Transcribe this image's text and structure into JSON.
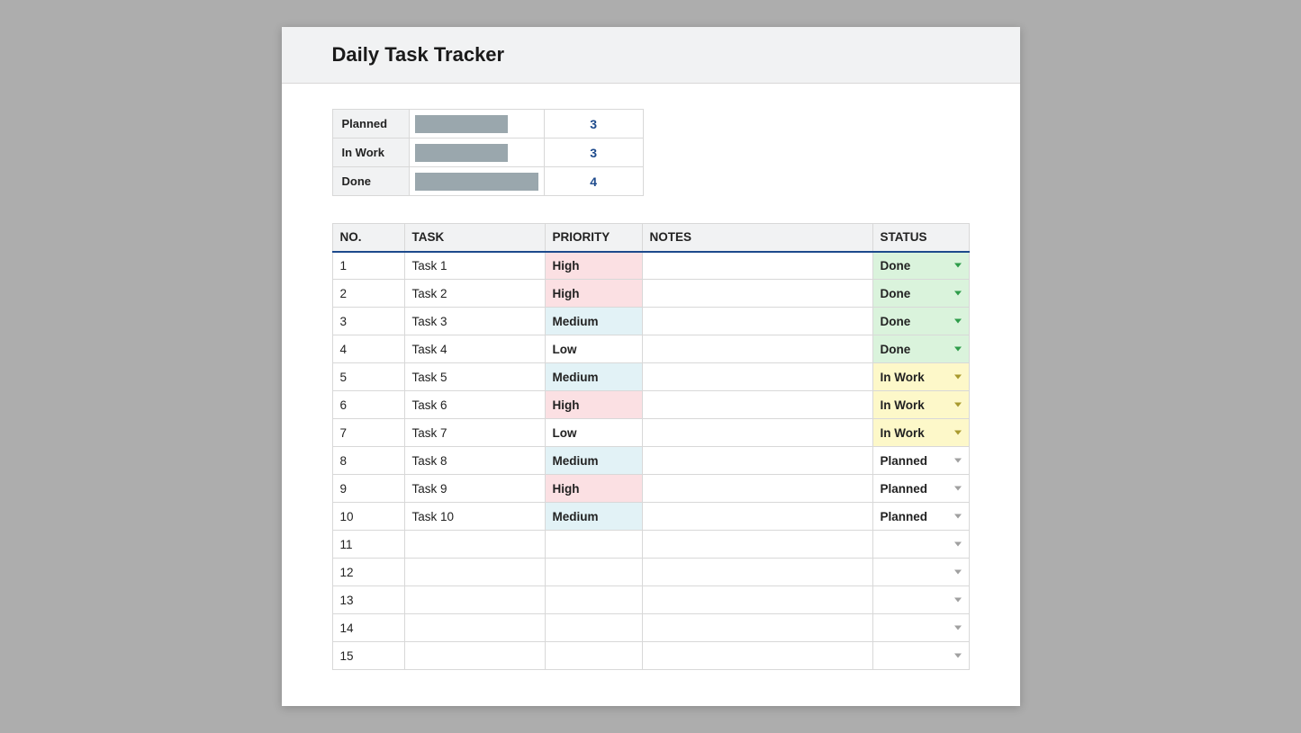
{
  "title": "Daily Task Tracker",
  "summary": {
    "max": 4,
    "rows": [
      {
        "label": "Planned",
        "count": 3
      },
      {
        "label": "In Work",
        "count": 3
      },
      {
        "label": "Done",
        "count": 4
      }
    ]
  },
  "tasks": {
    "headers": {
      "no": "NO.",
      "task": "TASK",
      "priority": "PRIORITY",
      "notes": "NOTES",
      "status": "STATUS"
    },
    "rows": [
      {
        "no": "1",
        "task": "Task 1",
        "priority": "High",
        "notes": "",
        "status": "Done"
      },
      {
        "no": "2",
        "task": "Task 2",
        "priority": "High",
        "notes": "",
        "status": "Done"
      },
      {
        "no": "3",
        "task": "Task 3",
        "priority": "Medium",
        "notes": "",
        "status": "Done"
      },
      {
        "no": "4",
        "task": "Task 4",
        "priority": "Low",
        "notes": "",
        "status": "Done"
      },
      {
        "no": "5",
        "task": "Task 5",
        "priority": "Medium",
        "notes": "",
        "status": "In Work"
      },
      {
        "no": "6",
        "task": "Task 6",
        "priority": "High",
        "notes": "",
        "status": "In Work"
      },
      {
        "no": "7",
        "task": "Task 7",
        "priority": "Low",
        "notes": "",
        "status": "In Work"
      },
      {
        "no": "8",
        "task": "Task 8",
        "priority": "Medium",
        "notes": "",
        "status": "Planned"
      },
      {
        "no": "9",
        "task": "Task 9",
        "priority": "High",
        "notes": "",
        "status": "Planned"
      },
      {
        "no": "10",
        "task": "Task 10",
        "priority": "Medium",
        "notes": "",
        "status": "Planned"
      },
      {
        "no": "11",
        "task": "",
        "priority": "",
        "notes": "",
        "status": ""
      },
      {
        "no": "12",
        "task": "",
        "priority": "",
        "notes": "",
        "status": ""
      },
      {
        "no": "13",
        "task": "",
        "priority": "",
        "notes": "",
        "status": ""
      },
      {
        "no": "14",
        "task": "",
        "priority": "",
        "notes": "",
        "status": ""
      },
      {
        "no": "15",
        "task": "",
        "priority": "",
        "notes": "",
        "status": ""
      }
    ]
  }
}
